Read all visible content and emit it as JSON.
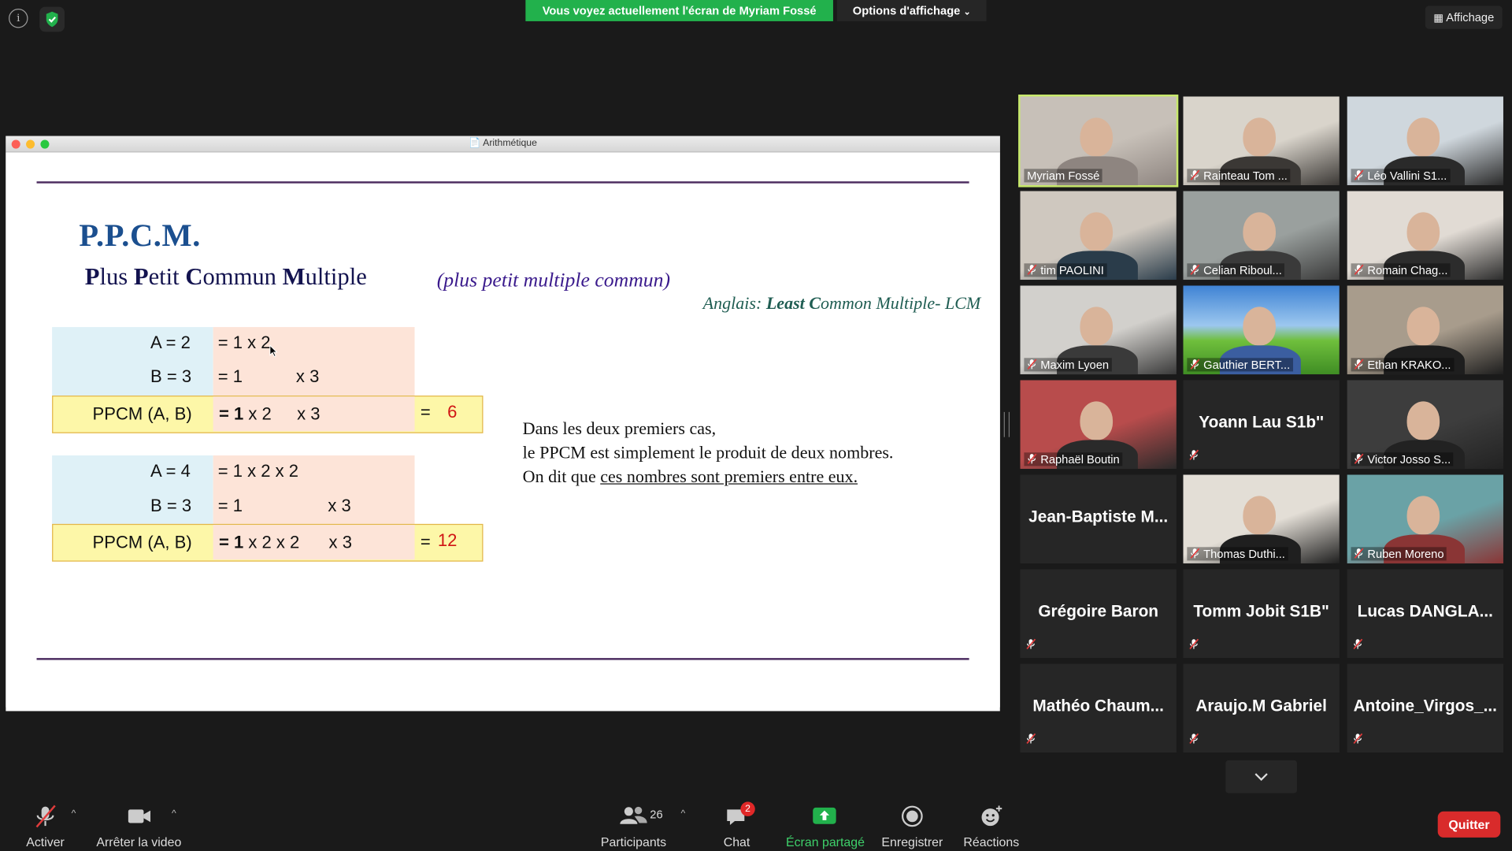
{
  "top_bar": {
    "sharing_banner": "Vous voyez actuellement l'écran de Myriam Fossé",
    "view_options": "Options d'affichage",
    "view_button": "Affichage"
  },
  "shared_window": {
    "title": "Arithmétique"
  },
  "slide": {
    "heading": "P.P.C.M.",
    "full_name_parts": [
      "P",
      "lus ",
      "P",
      "etit ",
      "C",
      "ommun ",
      "M",
      "ultiple"
    ],
    "paren": "(plus petit multiple commun)",
    "english_prefix": "Anglais: ",
    "english_least": "Least",
    "english_c": " C",
    "english_rest": "ommon Multiple-  LCM",
    "table1": {
      "a_label": "A = 2",
      "a_decomp": "= 1 x 2",
      "b_label": "B = 3",
      "b_decomp_1": "= 1",
      "b_decomp_2": "x 3",
      "ppcm_label": "PPCM (A, B)",
      "ppcm_one": "= 1",
      "ppcm_rest": " x 2",
      "ppcm_x3": "x 3",
      "eq": "=",
      "result": "6"
    },
    "table2": {
      "a_label": "A = 4",
      "a_decomp": "= 1 x 2 x 2",
      "b_label": "B = 3",
      "b_decomp_1": "= 1",
      "b_decomp_2": "x 3",
      "ppcm_label": "PPCM (A, B)",
      "ppcm_one": "= 1",
      "ppcm_rest": " x 2 x 2",
      "ppcm_x3": "x 3",
      "eq": "=",
      "result": "12"
    },
    "explanation": {
      "line1": "Dans les deux  premiers cas,",
      "line2": "le PPCM est simplement le produit de deux nombres.",
      "line3_prefix": "On dit que ",
      "line3_underlined": "ces nombres sont premiers entre eux."
    }
  },
  "participants_gallery": [
    {
      "name": "Myriam Fossé",
      "video": true,
      "muted": false,
      "active": true
    },
    {
      "name": "Rainteau Tom ...",
      "video": true,
      "muted": true
    },
    {
      "name": "Léo Vallini S1...",
      "video": true,
      "muted": true
    },
    {
      "name": "tim PAOLINI",
      "video": true,
      "muted": true
    },
    {
      "name": "Celian Riboul...",
      "video": true,
      "muted": true
    },
    {
      "name": "Romain Chag...",
      "video": true,
      "muted": true
    },
    {
      "name": "Maxim Lyoen",
      "video": true,
      "muted": true
    },
    {
      "name": "Gauthier BERT...",
      "video": true,
      "muted": true
    },
    {
      "name": "Ethan KRAKO...",
      "video": true,
      "muted": true
    },
    {
      "name": "Raphaël Boutin",
      "video": true,
      "muted": true
    },
    {
      "name": "Yoann Lau S1b''",
      "video": false,
      "muted": true
    },
    {
      "name": "Victor Josso S...",
      "video": true,
      "muted": true
    },
    {
      "name": "Jean-Baptiste  M...",
      "video": false,
      "muted": false
    },
    {
      "name": "Thomas Duthi...",
      "video": true,
      "muted": true
    },
    {
      "name": "Ruben Moreno",
      "video": true,
      "muted": true
    },
    {
      "name": "Grégoire Baron",
      "video": false,
      "muted": true
    },
    {
      "name": "Tomm Jobit S1B\"",
      "video": false,
      "muted": true
    },
    {
      "name": "Lucas  DANGLA...",
      "video": false,
      "muted": true
    },
    {
      "name": "Mathéo  Chaum...",
      "video": false,
      "muted": true
    },
    {
      "name": "Araujo.M Gabriel",
      "video": false,
      "muted": true
    },
    {
      "name": "Antoine_Virgos_...",
      "video": false,
      "muted": true
    }
  ],
  "toolbar": {
    "unmute_label": "Activer",
    "stop_video_label": "Arrêter la video",
    "participants_label": "Participants",
    "participants_count": "26",
    "chat_label": "Chat",
    "chat_badge": "2",
    "share_label": "Écran partagé",
    "record_label": "Enregistrer",
    "reactions_label": "Réactions",
    "quit_label": "Quitter"
  },
  "colors": {
    "banner_green": "#22b14c",
    "share_green": "#22b14c",
    "quit_red": "#d92b2b",
    "active_speaker": "#c7e86b",
    "slide_heading_blue": "#1b4f8f",
    "result_red": "#d01414"
  }
}
